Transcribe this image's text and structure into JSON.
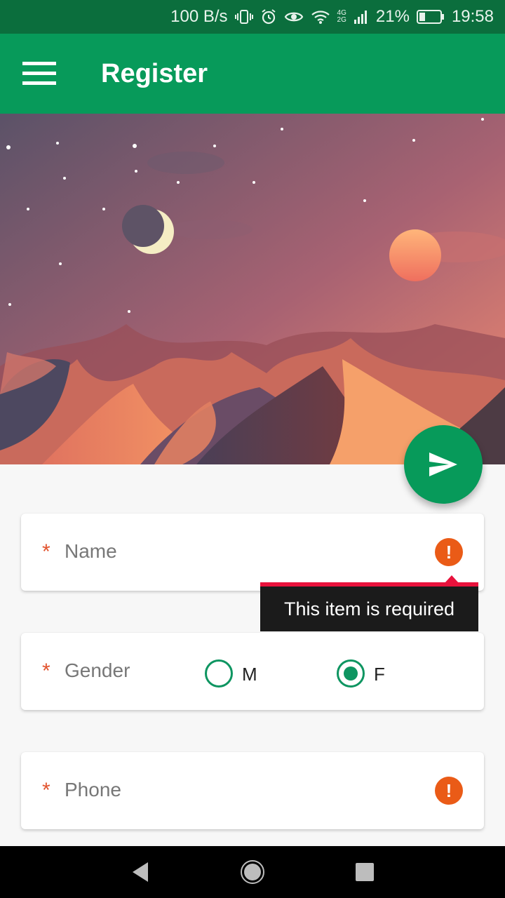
{
  "status_bar": {
    "net_speed": "100 B/s",
    "network": "4G",
    "network2": "2G",
    "battery": "21%",
    "time": "19:58",
    "icons": [
      "vibrate-icon",
      "alarm-icon",
      "eye-icon",
      "wifi-icon",
      "signal-icon",
      "battery-icon"
    ]
  },
  "app_bar": {
    "title": "Register",
    "menu_icon": "hamburger-icon"
  },
  "fab": {
    "icon": "send-icon"
  },
  "form": {
    "name": {
      "required_mark": "*",
      "label": "Name",
      "error_icon": "!"
    },
    "gender": {
      "required_mark": "*",
      "label": "Gender",
      "options": [
        {
          "label": "M",
          "selected": false
        },
        {
          "label": "F",
          "selected": true
        }
      ]
    },
    "phone": {
      "required_mark": "*",
      "label": "Phone",
      "error_icon": "!"
    }
  },
  "tooltip": {
    "text": "This item is required"
  },
  "nav": {
    "back_icon": "back-triangle-icon",
    "home_icon": "home-circle-icon",
    "recents_icon": "recents-square-icon"
  },
  "colors": {
    "primary": "#079a5a",
    "status_bar": "#0b6e3d",
    "error": "#ea5b17",
    "tooltip_accent": "#e8123c"
  }
}
